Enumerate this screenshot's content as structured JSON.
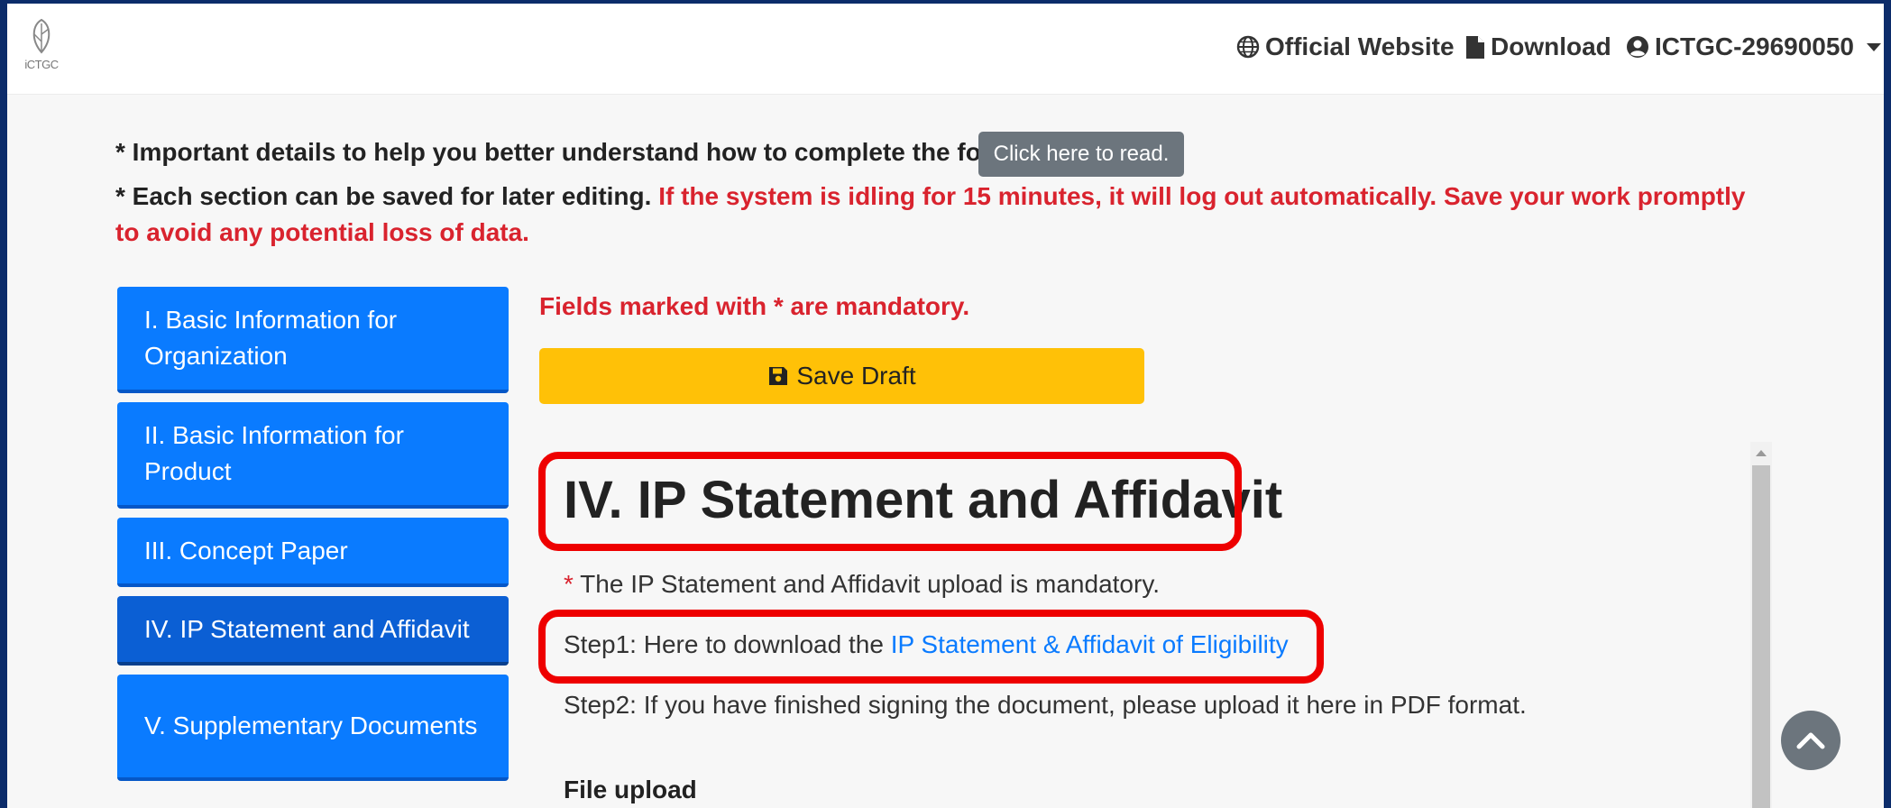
{
  "navbar": {
    "logo_text": "iCTGC",
    "links": {
      "official_website": "Official Website",
      "download": "Download",
      "user": "ICTGC-29690050"
    }
  },
  "notices": {
    "line1": "* Important details to help you better understand how to complete the form.",
    "read_button": "Click here to read.",
    "line2_prefix": "* Each section can be saved for later editing.",
    "line2_warning": "If the system is idling for 15 minutes, it will log out automatically. Save your work promptly to avoid any potential loss of data."
  },
  "sidebar": {
    "items": [
      {
        "label": "I. Basic Information for Organization"
      },
      {
        "label": "II. Basic Information for Product"
      },
      {
        "label": "III. Concept Paper"
      },
      {
        "label": "IV. IP Statement and Affidavit",
        "active": true
      },
      {
        "label": "V. Supplementary Documents"
      }
    ]
  },
  "main": {
    "mandatory_note": "Fields marked with * are mandatory.",
    "save_draft": "Save Draft",
    "section_title": "IV. IP Statement and Affidavit",
    "upload_required_star": "*",
    "upload_required_text": " The IP Statement and Affidavit upload is mandatory.",
    "step1_prefix": "Step1: Here to download the ",
    "step1_link": "IP Statement & Affidavit of Eligibility",
    "step2": "Step2: If you have finished signing the document, please upload it here in PDF format.",
    "file_upload_label": "File upload"
  },
  "colors": {
    "primary": "#0a7bff",
    "warning_red": "#d9232e",
    "save_yellow": "#ffc107",
    "highlight_red": "#ee0000"
  },
  "icons": [
    "globe-icon",
    "file-icon",
    "user-circle-icon",
    "save-icon",
    "chevron-up-icon"
  ]
}
